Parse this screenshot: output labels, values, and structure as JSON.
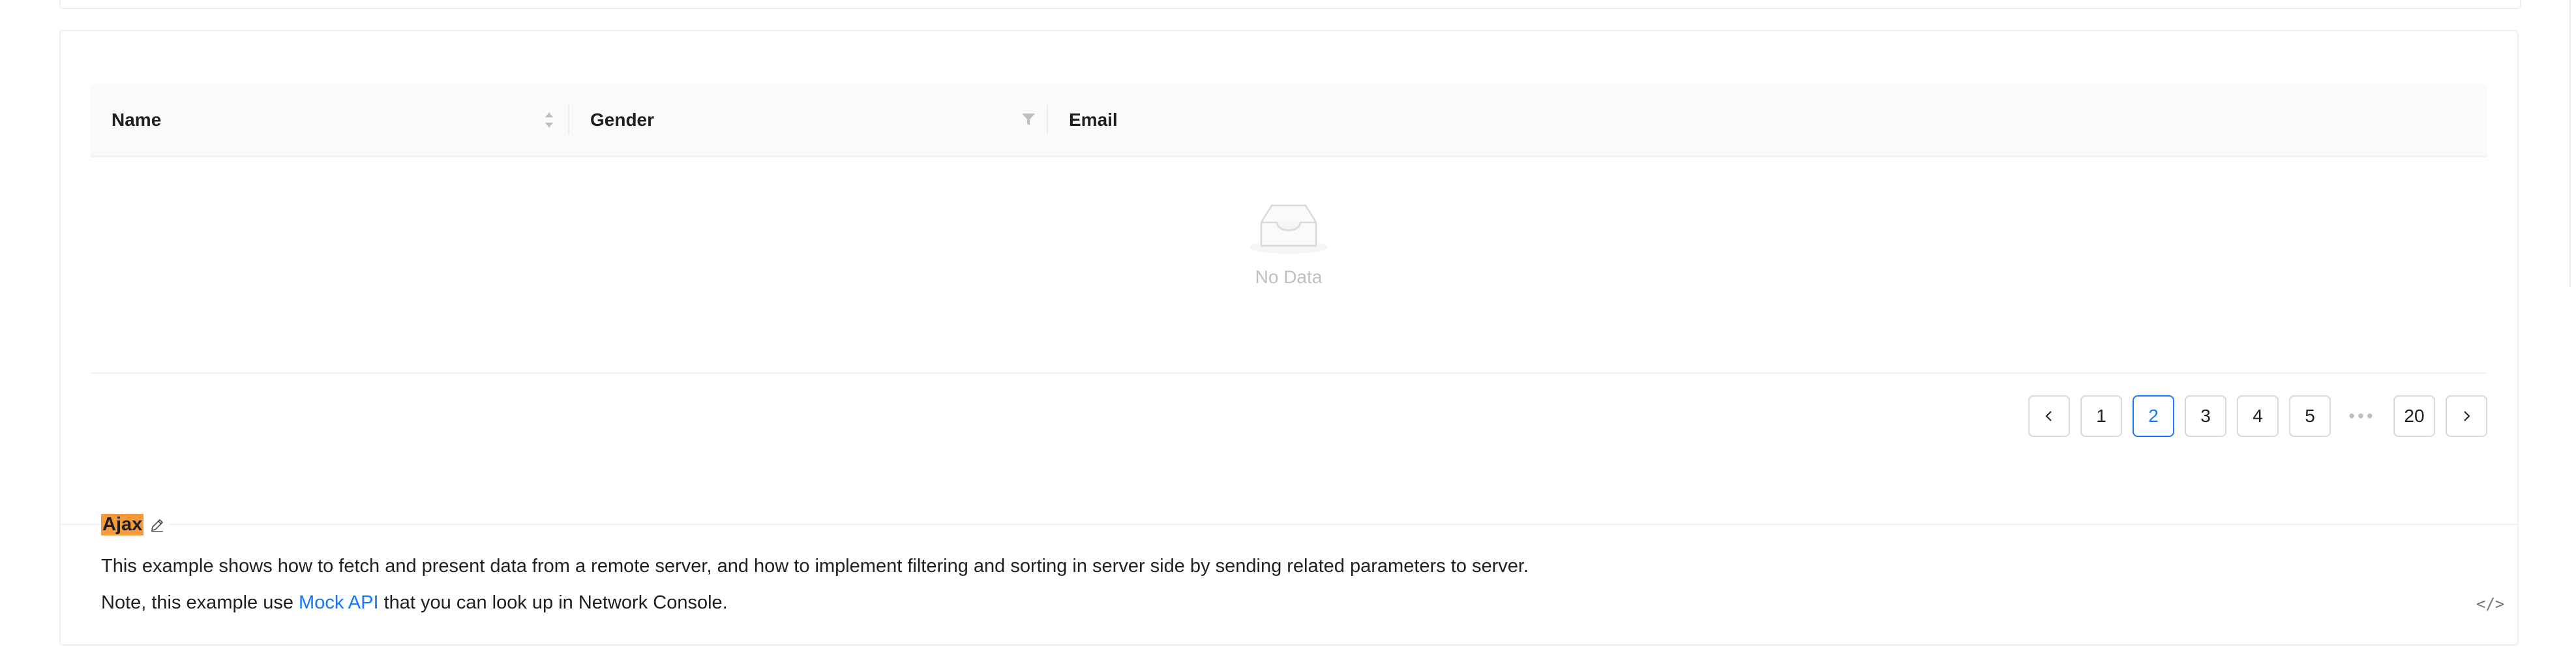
{
  "table": {
    "columns": [
      {
        "label": "Name",
        "sortable": true
      },
      {
        "label": "Gender",
        "filterable": true
      },
      {
        "label": "Email"
      }
    ],
    "empty_text": "No Data"
  },
  "pagination": {
    "prev_icon": "chevron-left-icon",
    "next_icon": "chevron-right-icon",
    "pages": [
      "1",
      "2",
      "3",
      "4",
      "5"
    ],
    "current": "2",
    "ellipsis": "•••",
    "last": "20"
  },
  "demo": {
    "title": "Ajax",
    "description": "This example shows how to fetch and present data from a remote server, and how to implement filtering and sorting in server side by sending related parameters to server.",
    "note_prefix": "Note, this example use ",
    "note_link": "Mock API",
    "note_suffix": " that you can look up in Network Console.",
    "code_toggle": "</>"
  },
  "colors": {
    "accent": "#1677ff",
    "highlight": "#f59a3c",
    "border": "#f0f0f0"
  }
}
